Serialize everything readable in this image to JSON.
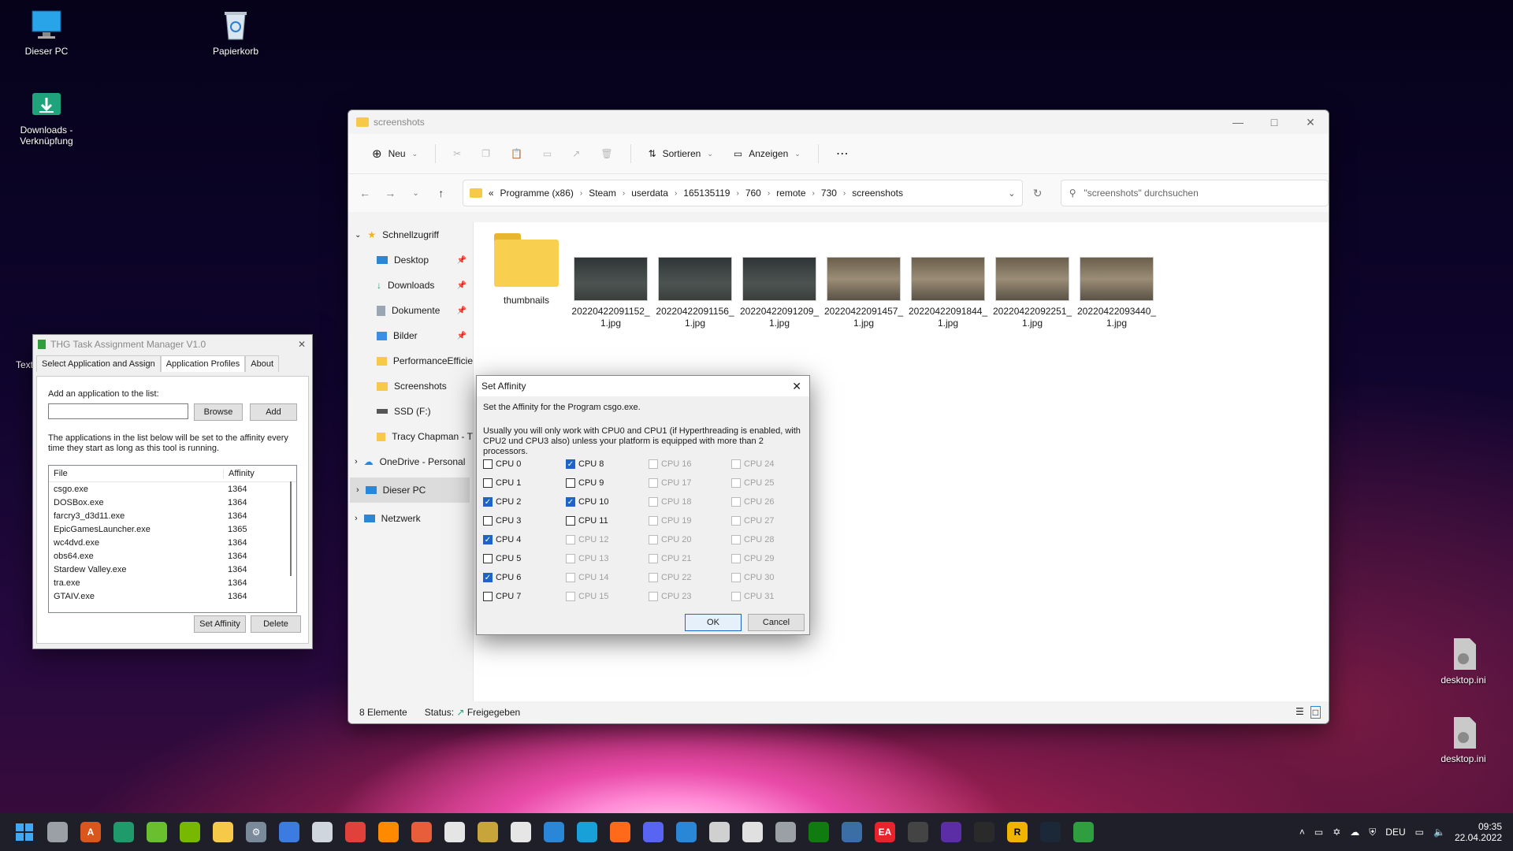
{
  "desktop": {
    "icons": [
      "Dieser PC",
      "Papierkorb",
      "Downloads - Verknüpfung",
      "Text",
      "desktop.ini",
      "desktop.ini"
    ]
  },
  "explorer": {
    "title": "screenshots",
    "toolbar": {
      "new": "Neu",
      "sort": "Sortieren",
      "view": "Anzeigen",
      "more": "⋯"
    },
    "breadcrumb_prefix": "«",
    "breadcrumb": [
      "Programme (x86)",
      "Steam",
      "userdata",
      "165135119",
      "760",
      "remote",
      "730",
      "screenshots"
    ],
    "search_placeholder": "\"screenshots\" durchsuchen",
    "nav": [
      "Schnellzugriff",
      "Desktop",
      "Downloads",
      "Dokumente",
      "Bilder",
      "PerformanceEfficie",
      "Screenshots",
      "SSD (F:)",
      "Tracy Chapman - T",
      "OneDrive - Personal",
      "Dieser PC",
      "Netzwerk"
    ],
    "files": [
      {
        "name": "thumbnails",
        "line2": ""
      },
      {
        "name": "20220422091152_",
        "line2": "1.jpg"
      },
      {
        "name": "20220422091156_",
        "line2": "1.jpg"
      },
      {
        "name": "20220422091209_",
        "line2": "1.jpg"
      },
      {
        "name": "20220422091457_",
        "line2": "1.jpg"
      },
      {
        "name": "20220422091844_",
        "line2": "1.jpg"
      },
      {
        "name": "20220422092251_",
        "line2": "1.jpg"
      },
      {
        "name": "20220422093440_",
        "line2": "1.jpg"
      }
    ],
    "status": {
      "count": "8 Elemente",
      "label": "Status:",
      "value": "Freigegeben"
    }
  },
  "thg": {
    "title": "THG Task Assignment Manager V1.0",
    "tabs": [
      "Select Application and Assign",
      "Application Profiles",
      "About"
    ],
    "add_label": "Add an application to the list:",
    "browse": "Browse",
    "add": "Add",
    "info": "The applications in the list below will be set to the affinity every time they start as long as this tool is running.",
    "col_file": "File",
    "col_affinity": "Affinity",
    "rows": [
      [
        "csgo.exe",
        "1364"
      ],
      [
        "DOSBox.exe",
        "1364"
      ],
      [
        "farcry3_d3d11.exe",
        "1364"
      ],
      [
        "EpicGamesLauncher.exe",
        "1365"
      ],
      [
        "wc4dvd.exe",
        "1364"
      ],
      [
        "obs64.exe",
        "1364"
      ],
      [
        "Stardew Valley.exe",
        "1364"
      ],
      [
        "tra.exe",
        "1364"
      ],
      [
        "GTAIV.exe",
        "1364"
      ]
    ],
    "set_affinity": "Set Affinity",
    "delete": "Delete"
  },
  "affinity": {
    "title": "Set Affinity",
    "line1": "Set the Affinity for the Program csgo.exe.",
    "line2": "Usually you will only work with CPU0 and CPU1 (if Hyperthreading is enabled, with CPU2 und CPU3 also) unless your platform is equipped with more than 2 processors.",
    "cpus": [
      "CPU 0",
      "CPU 1",
      "CPU 2",
      "CPU 3",
      "CPU 4",
      "CPU 5",
      "CPU 6",
      "CPU 7",
      "CPU 8",
      "CPU 9",
      "CPU 10",
      "CPU 11",
      "CPU 12",
      "CPU 13",
      "CPU 14",
      "CPU 15",
      "CPU 16",
      "CPU 17",
      "CPU 18",
      "CPU 19",
      "CPU 20",
      "CPU 21",
      "CPU 22",
      "CPU 23",
      "CPU 24",
      "CPU 25",
      "CPU 26",
      "CPU 27",
      "CPU 28",
      "CPU 29",
      "CPU 30",
      "CPU 31"
    ],
    "checked": [
      2,
      4,
      6,
      8,
      10
    ],
    "enabled_count": 12,
    "ok": "OK",
    "cancel": "Cancel"
  },
  "taskbar": {
    "lang": "DEU",
    "time": "09:35",
    "date": "22.04.2022"
  }
}
